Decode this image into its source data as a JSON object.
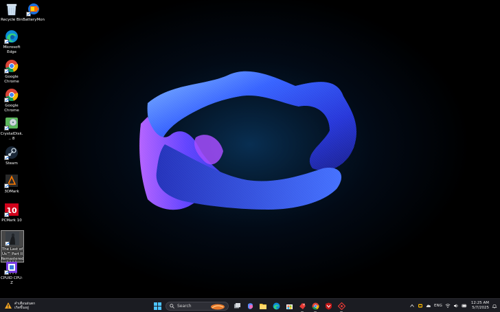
{
  "desktop": {
    "icons": [
      {
        "label": "Recycle Bin",
        "icon": "recycle-bin-icon"
      },
      {
        "label": "BatteryMon",
        "icon": "batterymon-icon"
      },
      {
        "label": "Microsoft Edge",
        "icon": "edge-icon"
      },
      {
        "label": "Google Chrome",
        "icon": "chrome-icon"
      },
      {
        "label": "Google Chrome",
        "icon": "chrome-icon"
      },
      {
        "label": "CrystalDisk... 8",
        "icon": "crystaldisk-icon"
      },
      {
        "label": "Steam",
        "icon": "steam-icon"
      },
      {
        "label": "3DMark",
        "icon": "3dmark-icon"
      },
      {
        "label": "PCMark 10",
        "icon": "pcmark-icon"
      },
      {
        "label": "The Last of Us™ Part II Remastered",
        "icon": "tlou-icon"
      },
      {
        "label": "CPUID CPU-Z",
        "icon": "cpuz-icon"
      }
    ]
  },
  "taskbar": {
    "weather": {
      "line1": "คำเตือนฝนตก",
      "line2": "เกิดขึ้นอยู่"
    },
    "search_placeholder": "Search",
    "tray": {
      "language": "ENG",
      "time": "12:25 AM",
      "date": "5/7/2025"
    }
  },
  "colors": {
    "taskbar": "#1b1c22",
    "accent": "#0078d4"
  }
}
